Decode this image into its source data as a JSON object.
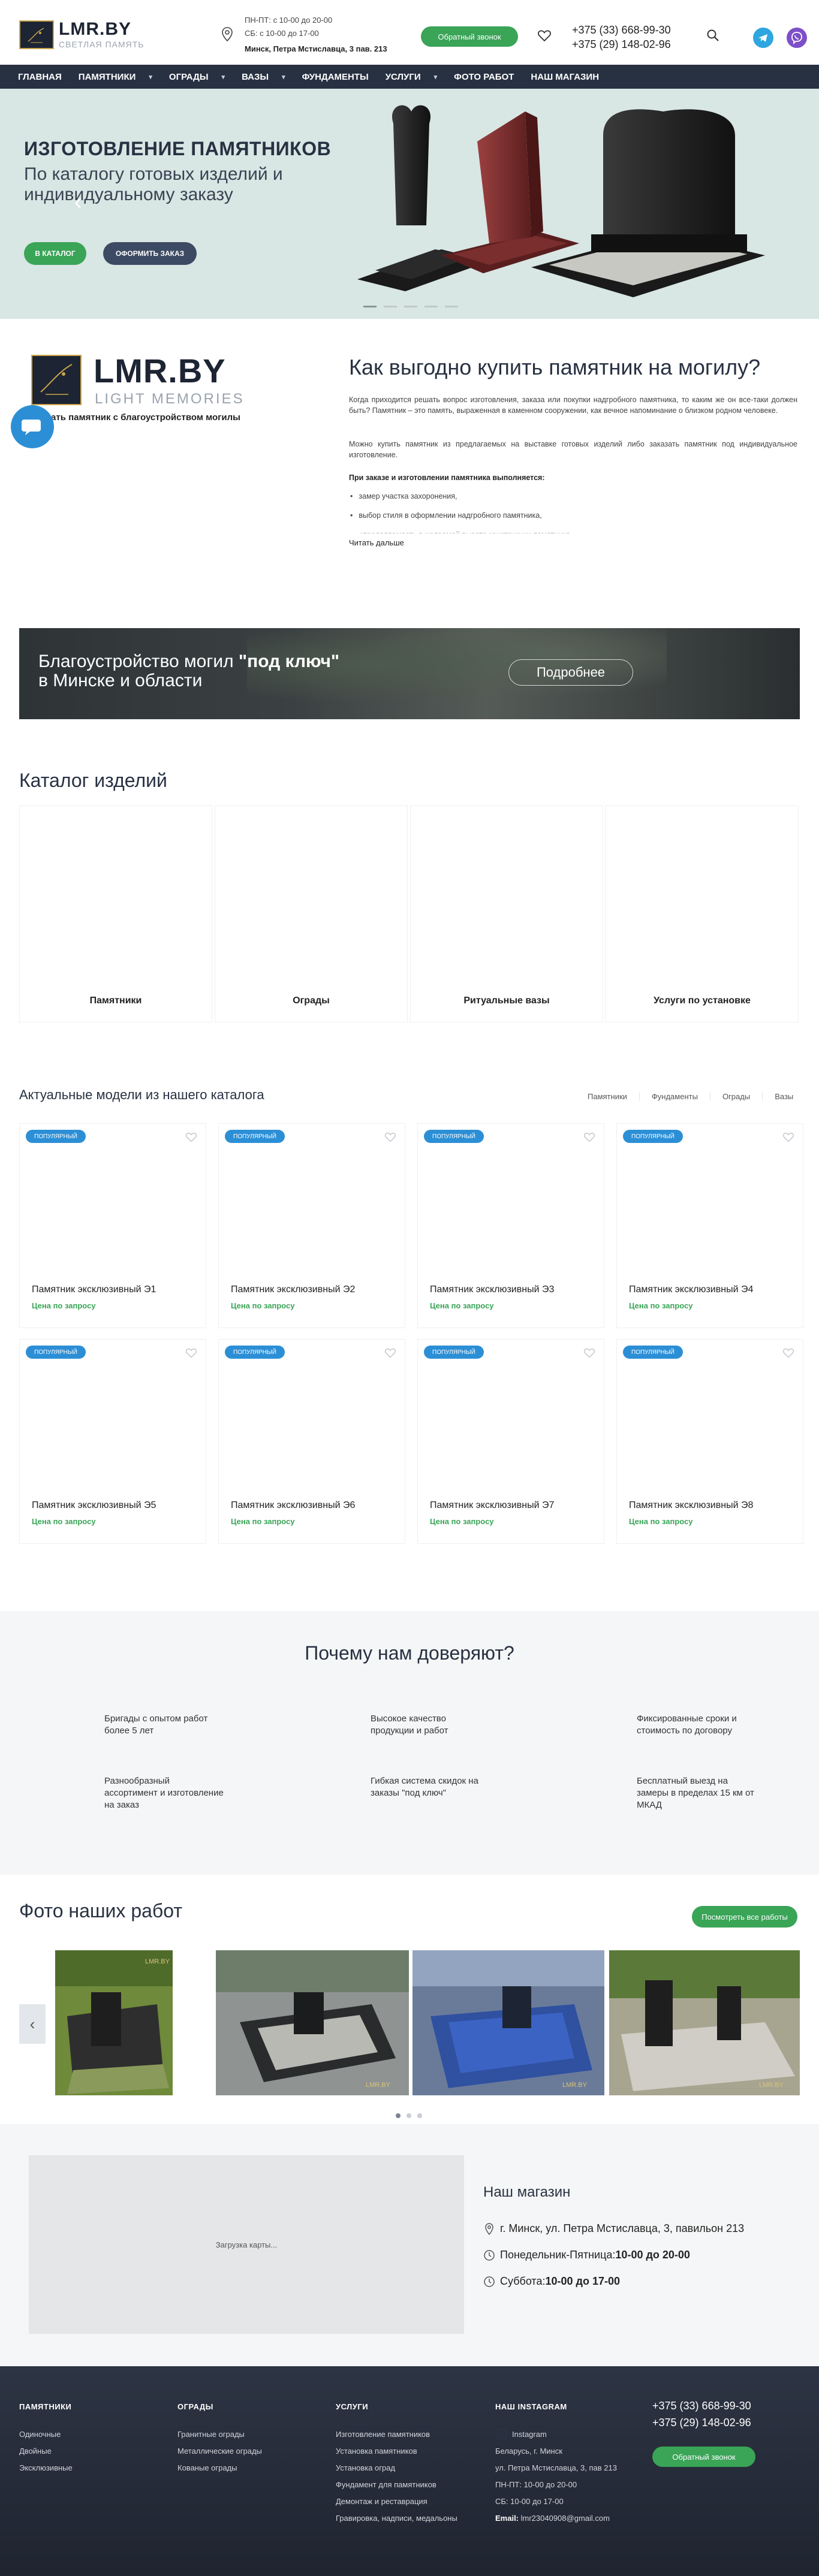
{
  "header": {
    "logo_title": "LMR.BY",
    "logo_sub": "СВЕТЛАЯ ПАМЯТЬ",
    "hours_weekdays": "ПН-ПТ: с 10-00 до 20-00",
    "hours_saturday": "СБ: с 10-00 до 17-00",
    "address": "Минск, Петра Мстиславца, 3 пав. 213",
    "callback_label": "Обратный звонок",
    "phone1": "+375 (33) 668-99-30",
    "phone2": "+375 (29) 148-02-96"
  },
  "nav": [
    {
      "label": "Главная",
      "dropdown": false
    },
    {
      "label": "Памятники",
      "dropdown": true
    },
    {
      "label": "Ограды",
      "dropdown": true
    },
    {
      "label": "Вазы",
      "dropdown": true
    },
    {
      "label": "Фундаменты",
      "dropdown": false
    },
    {
      "label": "Услуги",
      "dropdown": true
    },
    {
      "label": "Фото работ",
      "dropdown": false
    },
    {
      "label": "Наш магазин",
      "dropdown": false
    }
  ],
  "hero": {
    "title": "ИЗГОТОВЛЕНИЕ ПАМЯТНИКОВ",
    "subtitle": "По каталогу готовых изделий и индивидуальному заказу",
    "btn_catalog": "В каталог",
    "btn_order": "Оформить заказ",
    "slide_count": 5,
    "active_slide": 1
  },
  "intro": {
    "logo_title": "LMR.BY",
    "logo_sub": "LIGHT MEMORIES",
    "caption": "Заказать памятник с благоустройством могилы",
    "heading": "Как выгодно купить памятник на могилу?",
    "p1": "Когда приходится решать вопрос изготовления, заказа или покупки надгробного памятника, то каким же он все-таки должен быть? Памятник – это память, выраженная в каменном сооружении, как вечное напоминание о близком родном человеке.",
    "p2": "Можно купить памятник из предлагаемых на выставке готовых изделий либо заказать памятник под индивидуальное изготовление.",
    "p3": "При заказе и изготовлении памятника выполняется:",
    "bullets": [
      "замер участка захоронения,",
      "выбор стиля в оформлении надгробного памятника,",
      "определяемость в желаемой высоте конструкции памятника,"
    ],
    "read_more": "Читать дальше"
  },
  "banner": {
    "line1_pre": "Благоустройство могил ",
    "line1_bold": "\"под ключ\"",
    "line2": "в Минске и области",
    "button": "Подробнее"
  },
  "catalog": {
    "title": "Каталог изделий",
    "items": [
      "Памятники",
      "Ограды",
      "Ритуальные вазы",
      "Услуги по установке"
    ]
  },
  "models": {
    "title": "Актуальные модели из нашего каталога",
    "tabs": [
      "Памятники",
      "Фундаменты",
      "Ограды",
      "Вазы"
    ],
    "badge": "популярный",
    "price": "Цена по запросу",
    "items": [
      "Памятник эксклюзивный Э1",
      "Памятник эксклюзивный Э2",
      "Памятник эксклюзивный Э3",
      "Памятник эксклюзивный Э4",
      "Памятник эксклюзивный Э5",
      "Памятник эксклюзивный Э6",
      "Памятник эксклюзивный Э7",
      "Памятник эксклюзивный Э8"
    ]
  },
  "why": {
    "title": "Почему нам доверяют?",
    "items": [
      "Бригады с опытом работ более 5 лет",
      "Высокое качество продукции и работ",
      "Фиксированные сроки и стоимость по договору",
      "Разнообразный ассортимент и изготовление на заказ",
      "Гибкая система скидок на заказы \"под ключ\"",
      "Бесплатный выезд на замеры в пределах 15 км от МКАД"
    ]
  },
  "photos": {
    "title": "Фото наших работ",
    "see_all": "Посмотреть все работы",
    "watermark": "LMR.BY",
    "page_count": 3,
    "active_page": 1
  },
  "shop": {
    "map_loading": "Загрузка карты...",
    "title": "Наш магазин",
    "address": "г. Минск, ул. Петра Мстиславца, 3, павильон 213",
    "weekdays_pre": "Понедельник-Пятница: ",
    "weekdays_time": "10-00 до 20-00",
    "saturday_pre": "Суббота: ",
    "saturday_time": "10-00 до 17-00"
  },
  "footer": {
    "col1_title": "Памятники",
    "col1": [
      "Одиночные",
      "Двойные",
      "Эксклюзивные"
    ],
    "col2_title": "Ограды",
    "col2": [
      "Гранитные ограды",
      "Металлические ограды",
      "Кованые ограды"
    ],
    "col3_title": "Услуги",
    "col3": [
      "Изготовление памятников",
      "Установка памятников",
      "Установка оград",
      "Фундамент для памятников",
      "Демонтаж и реставрация",
      "Гравировка, надписи, медальоны"
    ],
    "col4_title": "Наш instagram",
    "instagram": "Instagram",
    "col4": [
      "Беларусь, г. Минск",
      "ул. Петра Мстиславца, 3, пав 213",
      "ПН-ПТ: 10-00 до 20-00",
      "СБ: 10-00 до 17-00"
    ],
    "email_label": "Email: ",
    "email": "lmr23040908@gmail.com",
    "phone1": "+375 (33) 668-99-30",
    "phone2": "+375 (29) 148-02-96",
    "callback_label": "Обратный звонок"
  }
}
